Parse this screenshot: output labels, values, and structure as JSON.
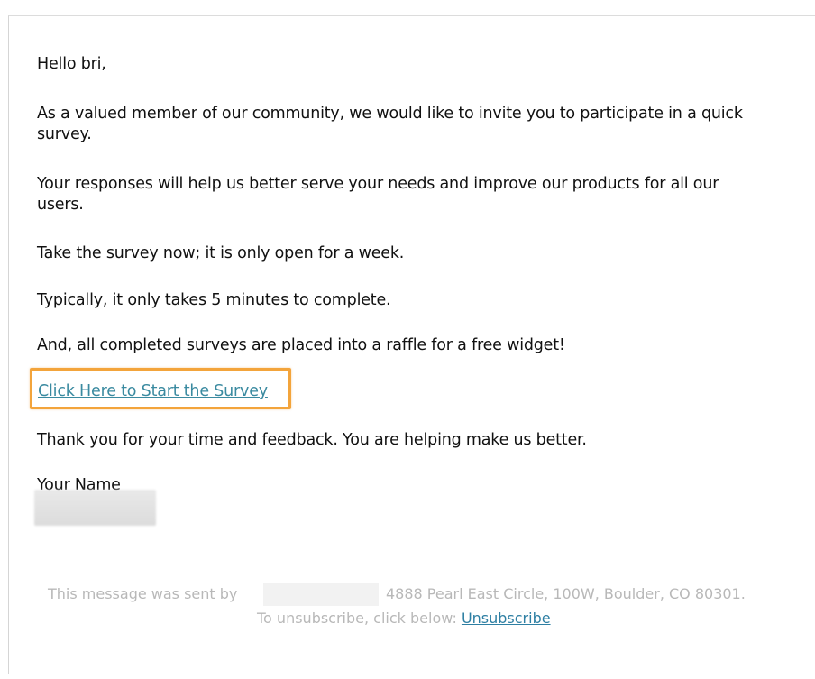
{
  "email": {
    "greeting": "Hello bri,",
    "paragraph1_line1": "As a valued member of our community, we would like to invite you to participate in a quick",
    "paragraph1_line2": "survey.",
    "paragraph2_line1": "Your responses will help us better serve your needs and improve our products for all our",
    "paragraph2_line2": "users.",
    "paragraph3": "Take the survey now; it is only open for a week.",
    "paragraph4": "Typically, it only takes 5 minutes to complete.",
    "paragraph5": "And, all completed surveys are placed into a raffle for a free widget!",
    "survey_link_label": "Click Here to Start the Survey",
    "thanks": "Thank you for your time and feedback. You are helping make us better.",
    "signature": "Your Name"
  },
  "footer": {
    "sent_by_prefix": "This message was sent by",
    "address": "4888 Pearl East Circle, 100W, Boulder, CO 80301.",
    "unsubscribe_prefix": "To unsubscribe, click below:",
    "unsubscribe_label": "Unsubscribe"
  },
  "colors": {
    "link": "#3a8aa0",
    "highlight_border": "#f3a43b",
    "footer_text": "#b8b8b8"
  }
}
